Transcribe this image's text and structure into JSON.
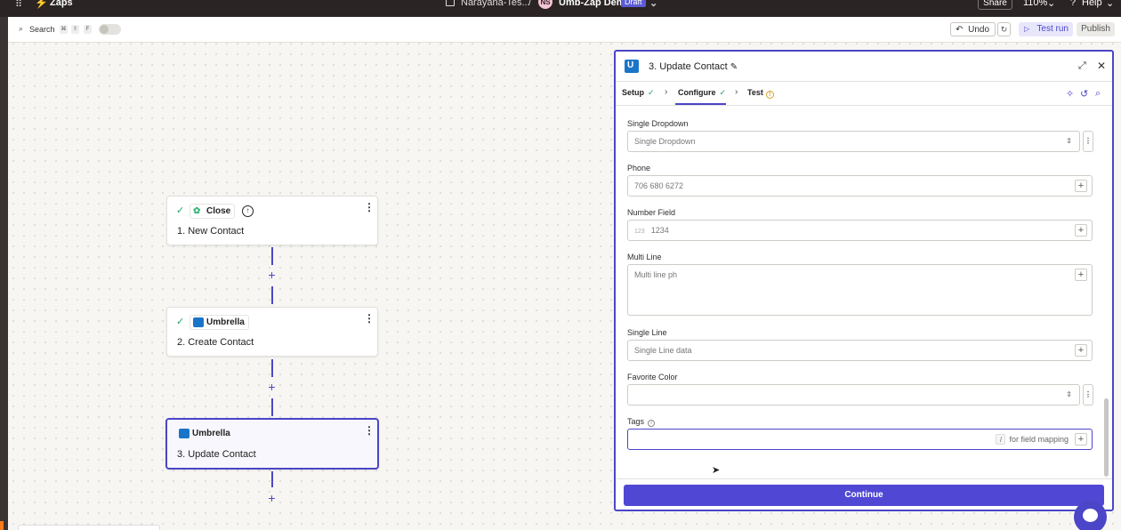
{
  "topbar": {
    "app": "Zaps",
    "folder": "Narayana-Tes...",
    "separator": "/",
    "avatar": "NS",
    "zap_name": "Umb-Zap Demo",
    "status": "Draft",
    "share": "Share",
    "zoom": "110%",
    "help": "Help"
  },
  "toolbar": {
    "search": "Search",
    "keys": [
      "⌘",
      "⇧",
      "F"
    ],
    "undo": "Undo",
    "test_run": "Test run",
    "publish": "Publish"
  },
  "steps": [
    {
      "app": "Close",
      "title": "1. New Contact",
      "status": "complete"
    },
    {
      "app": "Umbrella",
      "title": "2. Create Contact",
      "status": "complete"
    },
    {
      "app": "Umbrella",
      "title": "3. Update Contact",
      "status": "selected"
    }
  ],
  "panel": {
    "title": "3. Update Contact",
    "tabs": [
      "Setup",
      "Configure",
      "Test"
    ],
    "fields": {
      "single_dropdown": {
        "label": "Single Dropdown",
        "placeholder": "Single Dropdown"
      },
      "phone": {
        "label": "Phone",
        "placeholder": "706 680 6272"
      },
      "number": {
        "label": "Number Field",
        "placeholder": "1234",
        "prefix": "123"
      },
      "multi_line": {
        "label": "Multi Line",
        "placeholder": "Multi line ph"
      },
      "single_line": {
        "label": "Single Line",
        "placeholder": "Single Line data"
      },
      "favorite_color": {
        "label": "Favorite Color",
        "placeholder": ""
      },
      "tags": {
        "label": "Tags",
        "hint_key": "/",
        "hint": "for field mapping"
      }
    },
    "continue": "Continue"
  },
  "colors": {
    "accent": "#4b45c8",
    "brand": "#ff4f00",
    "success": "#21a366"
  }
}
